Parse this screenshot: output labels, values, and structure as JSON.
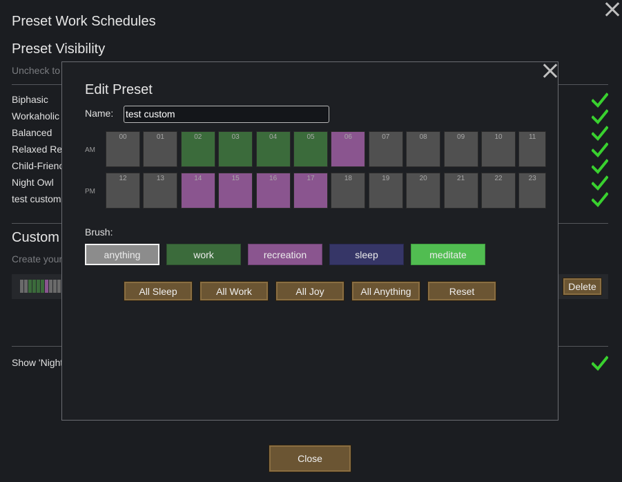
{
  "window": {
    "title": "Preset Work Schedules",
    "visibility_heading": "Preset Visibility",
    "visibility_hint": "Uncheck to",
    "presets": [
      "Biphasic",
      "Workaholic",
      "Balanced",
      "Relaxed Re",
      "Child-Frienc",
      "Night Owl",
      "test custom"
    ],
    "custom_heading": "Custom",
    "custom_hint": "Create your",
    "delete_label": "Delete",
    "show_night_label": "Show 'Night",
    "close_label": "Close"
  },
  "dialog": {
    "title": "Edit Preset",
    "name_label": "Name:",
    "name_value": "test custom",
    "am_label": "AM",
    "pm_label": "PM",
    "hours_am": [
      "00",
      "01",
      "02",
      "03",
      "04",
      "05",
      "06",
      "07",
      "08",
      "09",
      "10",
      "11"
    ],
    "hours_pm": [
      "12",
      "13",
      "14",
      "15",
      "16",
      "17",
      "18",
      "19",
      "20",
      "21",
      "22",
      "23"
    ],
    "schedule": [
      "anything",
      "anything",
      "work",
      "work",
      "work",
      "work",
      "recreation",
      "anything",
      "anything",
      "anything",
      "anything",
      "anything",
      "anything",
      "anything",
      "recreation",
      "recreation",
      "recreation",
      "recreation",
      "anything",
      "anything",
      "anything",
      "anything",
      "anything",
      "anything"
    ],
    "brush_label": "Brush:",
    "brushes": [
      "anything",
      "work",
      "recreation",
      "sleep",
      "meditate"
    ],
    "selected_brush": "anything",
    "actions": [
      "All Sleep",
      "All Work",
      "All Joy",
      "All Anything",
      "Reset"
    ]
  },
  "colors": {
    "anything": "#505050",
    "work": "#3b6b3b",
    "recreation": "#8a558f",
    "sleep": "#363667",
    "meditate": "#51bd51",
    "brush_anything": "#8c8c8c",
    "check": "#39d12f",
    "wood": "#6b5533"
  },
  "icons": {
    "close": "close-icon",
    "check": "checkmark-icon"
  },
  "mini_schedule_colors": [
    "anything",
    "anything",
    "work",
    "work",
    "work",
    "work",
    "recreation",
    "anything",
    "anything",
    "anything"
  ]
}
